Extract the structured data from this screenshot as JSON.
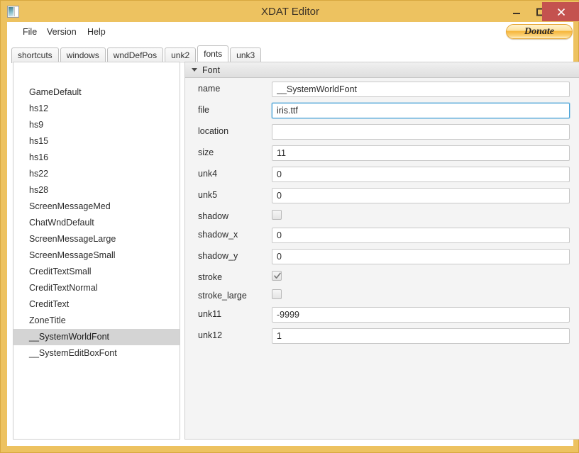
{
  "window": {
    "title": "XDAT Editor",
    "icon": "document-icon",
    "controls": {
      "minimize": "minimize-icon",
      "maximize": "maximize-icon",
      "close": "close-icon"
    },
    "colors": {
      "frame": "#edc260",
      "close_button": "#c4524f",
      "selection": "#d4d4d4",
      "focus_border": "#4aa3d8",
      "panel_bg": "#f4f4f4"
    }
  },
  "menubar": {
    "items": [
      {
        "label": "File"
      },
      {
        "label": "Version"
      },
      {
        "label": "Help"
      }
    ],
    "donate": {
      "label": "Donate"
    }
  },
  "tabs": [
    {
      "label": "shortcuts",
      "active": false
    },
    {
      "label": "windows",
      "active": false
    },
    {
      "label": "wndDefPos",
      "active": false
    },
    {
      "label": "unk2",
      "active": false
    },
    {
      "label": "fonts",
      "active": true
    },
    {
      "label": "unk3",
      "active": false
    }
  ],
  "list": {
    "selected": "__SystemWorldFont",
    "items": [
      {
        "label": "GameDefault",
        "selected": false
      },
      {
        "label": "hs12",
        "selected": false
      },
      {
        "label": "hs9",
        "selected": false
      },
      {
        "label": "hs15",
        "selected": false
      },
      {
        "label": "hs16",
        "selected": false
      },
      {
        "label": "hs22",
        "selected": false
      },
      {
        "label": "hs28",
        "selected": false
      },
      {
        "label": "ScreenMessageMed",
        "selected": false
      },
      {
        "label": "ChatWndDefault",
        "selected": false
      },
      {
        "label": "ScreenMessageLarge",
        "selected": false
      },
      {
        "label": "ScreenMessageSmall",
        "selected": false
      },
      {
        "label": "CreditTextSmall",
        "selected": false
      },
      {
        "label": "CreditTextNormal",
        "selected": false
      },
      {
        "label": "CreditText",
        "selected": false
      },
      {
        "label": "ZoneTitle",
        "selected": false
      },
      {
        "label": "__SystemWorldFont",
        "selected": true
      },
      {
        "label": "__SystemEditBoxFont",
        "selected": false
      }
    ]
  },
  "form": {
    "group_title": "Font",
    "group_expanded": true,
    "fields": [
      {
        "label": "name",
        "type": "text",
        "value": "__SystemWorldFont",
        "focused": false
      },
      {
        "label": "file",
        "type": "text",
        "value": "iris.ttf",
        "focused": true
      },
      {
        "label": "location",
        "type": "text",
        "value": "",
        "focused": false
      },
      {
        "label": "size",
        "type": "text",
        "value": "11",
        "focused": false
      },
      {
        "label": "unk4",
        "type": "text",
        "value": "0",
        "focused": false
      },
      {
        "label": "unk5",
        "type": "text",
        "value": "0",
        "focused": false
      },
      {
        "label": "shadow",
        "type": "checkbox",
        "checked": false
      },
      {
        "label": "shadow_x",
        "type": "text",
        "value": "0",
        "focused": false
      },
      {
        "label": "shadow_y",
        "type": "text",
        "value": "0",
        "focused": false
      },
      {
        "label": "stroke",
        "type": "checkbox",
        "checked": true
      },
      {
        "label": "stroke_large",
        "type": "checkbox",
        "checked": false
      },
      {
        "label": "unk11",
        "type": "text",
        "value": "-9999",
        "focused": false
      },
      {
        "label": "unk12",
        "type": "text",
        "value": "1",
        "focused": false
      }
    ]
  }
}
